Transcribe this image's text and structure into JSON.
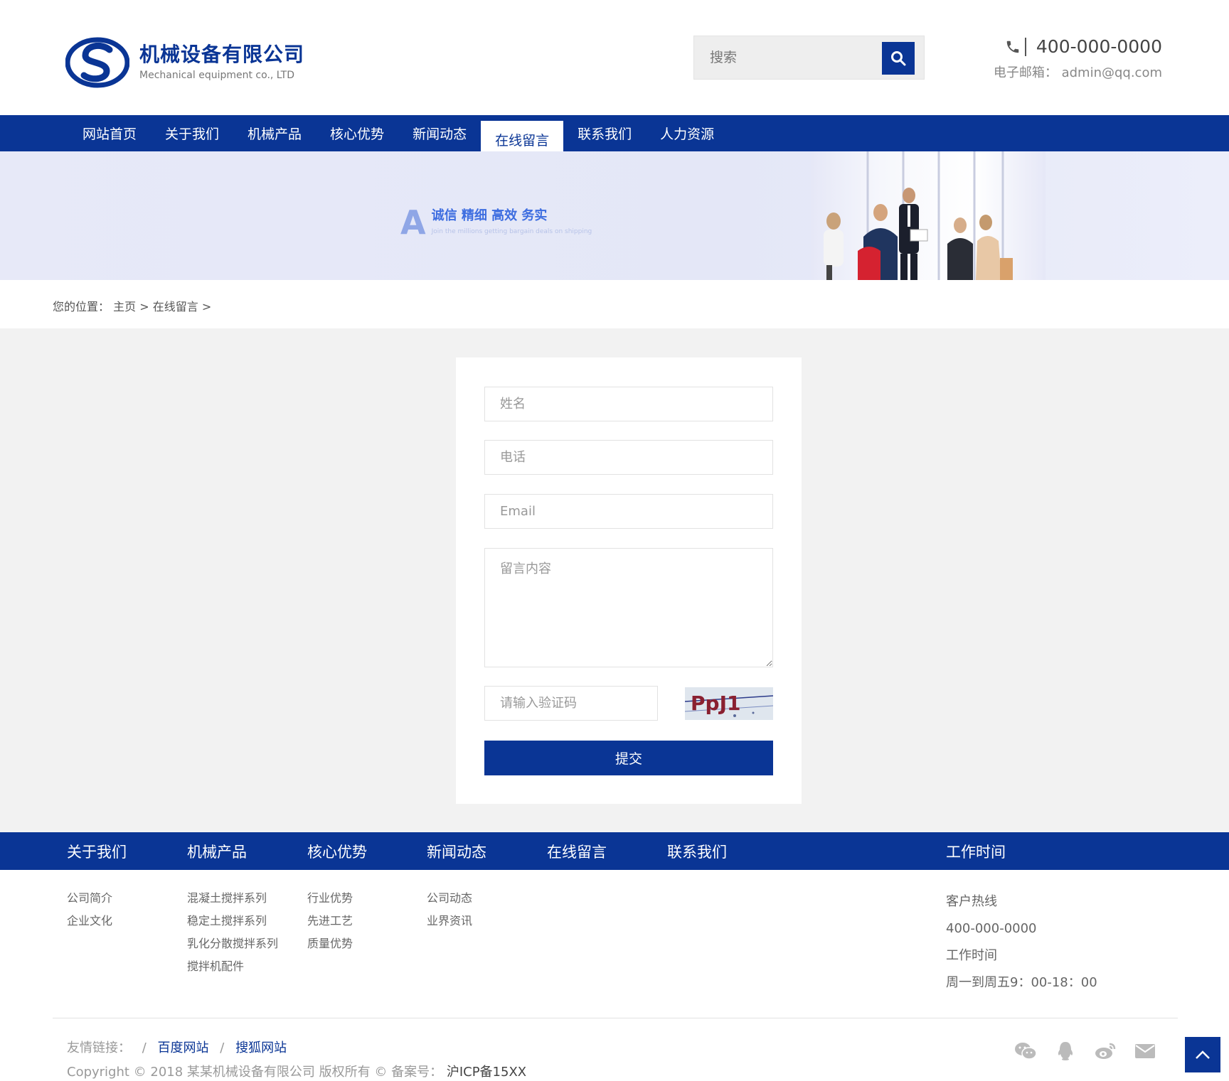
{
  "colors": {
    "brand": "#0a3595",
    "page_bg": "#f2f2f2",
    "banner_bg": "#e6e8f7"
  },
  "header": {
    "logo_title": "机械设备有限公司",
    "logo_subtitle": "Mechanical equipment co., LTD",
    "search_placeholder": "搜索",
    "phone": "400-000-0000",
    "email_label": "电子邮箱：",
    "email": "admin@qq.com"
  },
  "nav": {
    "items": [
      {
        "label": "网站首页"
      },
      {
        "label": "关于我们"
      },
      {
        "label": "机械产品"
      },
      {
        "label": "核心优势"
      },
      {
        "label": "新闻动态"
      },
      {
        "label": "在线留言",
        "active": true
      },
      {
        "label": "联系我们"
      },
      {
        "label": "人力资源"
      }
    ]
  },
  "banner": {
    "letter": "A",
    "slogan": "诚信 精细 高效 务实",
    "sub": "Join the millions getting bargain deals on shipping"
  },
  "breadcrumb": {
    "prefix": "您的位置：",
    "home": "主页",
    "sep": ">",
    "current": "在线留言"
  },
  "form": {
    "name_placeholder": "姓名",
    "phone_placeholder": "电话",
    "email_placeholder": "Email",
    "message_placeholder": "留言内容",
    "captcha_placeholder": "请输入验证码",
    "captcha_text": "PpJ1",
    "submit_label": "提交"
  },
  "footer": {
    "columns": [
      {
        "title": "关于我们",
        "items": [
          "公司简介",
          "企业文化"
        ]
      },
      {
        "title": "机械产品",
        "items": [
          "混凝土搅拌系列",
          "稳定土搅拌系列",
          "乳化分散搅拌系列",
          "搅拌机配件"
        ]
      },
      {
        "title": "核心优势",
        "items": [
          "行业优势",
          "先进工艺",
          "质量优势"
        ]
      },
      {
        "title": "新闻动态",
        "items": [
          "公司动态",
          "业界资讯"
        ]
      },
      {
        "title": "在线留言",
        "items": []
      },
      {
        "title": "联系我们",
        "items": []
      }
    ],
    "work": {
      "title": "工作时间",
      "hotline_label": "客户热线",
      "hotline": "400-000-0000",
      "hours_label": "工作时间",
      "hours": "周一到周五9：00-18：00"
    },
    "links_label": "友情链接：",
    "links": [
      "百度网站",
      "搜狐网站"
    ],
    "copyright": "Copyright © 2018 某某机械设备有限公司 版权所有 © 备案号：",
    "icp": "沪ICP备15XX",
    "social_icons": [
      "wechat-icon",
      "qq-icon",
      "weibo-icon",
      "mail-icon"
    ]
  }
}
